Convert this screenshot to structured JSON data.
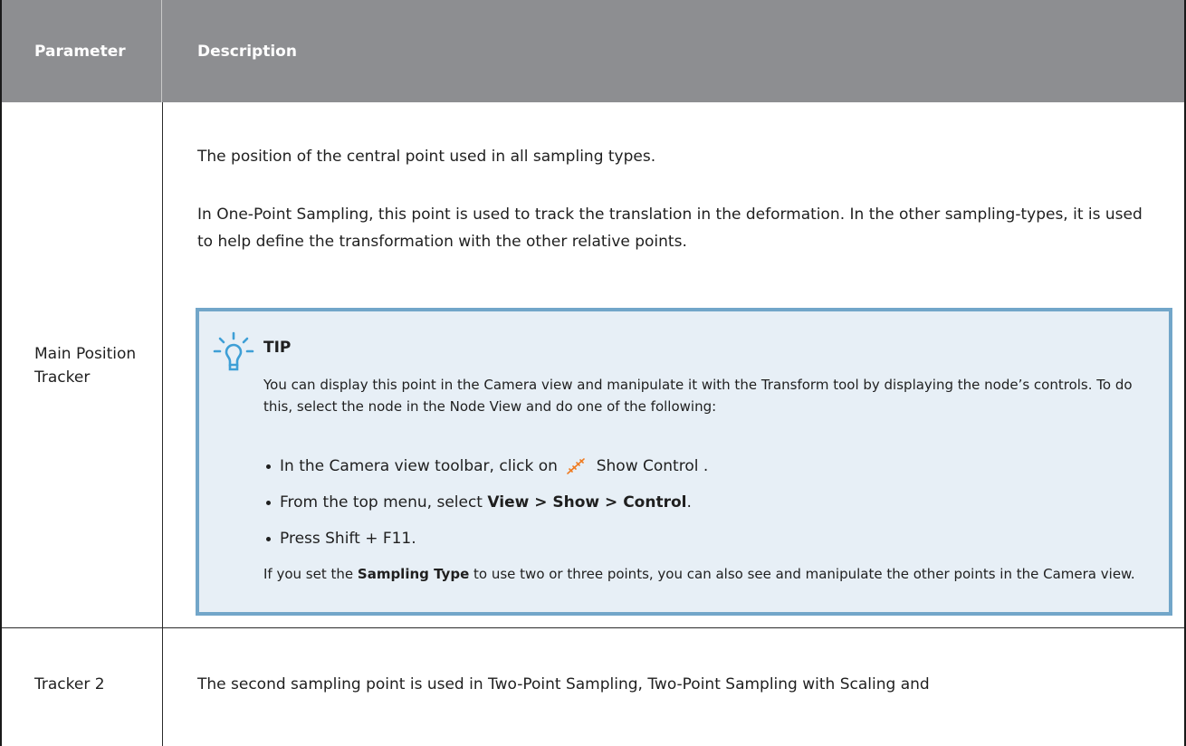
{
  "table": {
    "header": {
      "parameter": "Parameter",
      "description": "Description"
    },
    "row1": {
      "parameter": "Main Position Tracker",
      "desc_1": "The position of the central point used in all sampling types.",
      "desc_2": "In One-Point Sampling, this point is used to track the translation in the deformation. In the other sampling-types, it is used to help define the transformation with the other relative points.",
      "tip": {
        "icon": "lightbulb-icon",
        "title": "TIP",
        "body": "You can display this point in the Camera view and manipulate it with the Transform tool by displaying the node’s controls. To do this, select the node in the Node View and do one of the following:",
        "bullet1_before": "In the Camera view toolbar, click on",
        "bullet1_icon": "show-control-icon",
        "bullet1_after": "Show Control .",
        "bullet2_before": "From the top menu, select ",
        "bullet2_bold": "View > Show > Control",
        "bullet2_after": ".",
        "bullet3": "Press Shift + F11.",
        "footer_before": "If you set the ",
        "footer_bold": "Sampling Type",
        "footer_after": " to use two or three points, you can also see and manipulate the other points in the Camera view."
      }
    },
    "row2": {
      "parameter": "Tracker 2",
      "desc": "The second sampling point is used in Two-Point Sampling, Two-Point Sampling with Scaling and"
    }
  },
  "colors": {
    "header_bg": "#8d8e91",
    "tip_bg": "#e7eff6",
    "tip_border": "#72a6c9",
    "icon_blue": "#3e9fd6",
    "icon_orange": "#ef7c22"
  }
}
